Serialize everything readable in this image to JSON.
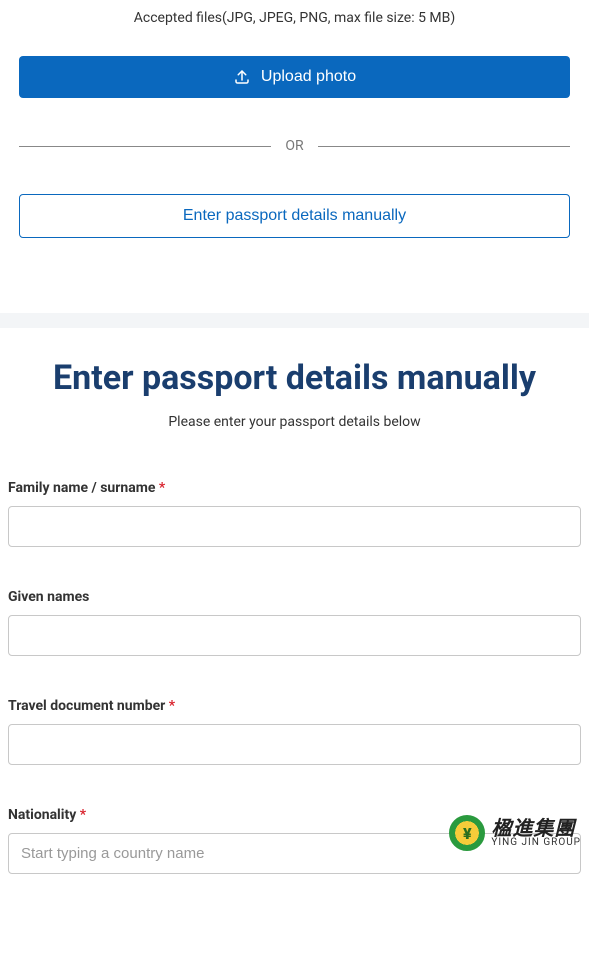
{
  "upload": {
    "accepted_files": "Accepted files(JPG, JPEG, PNG, max file size: 5 MB)",
    "button_label": "Upload photo",
    "divider_text": "OR",
    "manual_link_label": "Enter passport details manually"
  },
  "form": {
    "title": "Enter passport details manually",
    "subtitle": "Please enter your passport details below",
    "required_mark": "*",
    "fields": {
      "family_name": {
        "label": "Family name / surname ",
        "value": "",
        "required": true
      },
      "given_names": {
        "label": "Given names",
        "value": "",
        "required": false
      },
      "travel_document": {
        "label": "Travel document number ",
        "value": "",
        "required": true
      },
      "nationality": {
        "label": "Nationality ",
        "value": "",
        "required": true,
        "placeholder": "Start typing a country name"
      }
    }
  },
  "watermark": {
    "chinese": "楹進集團",
    "english": "YING JIN GROUP"
  }
}
